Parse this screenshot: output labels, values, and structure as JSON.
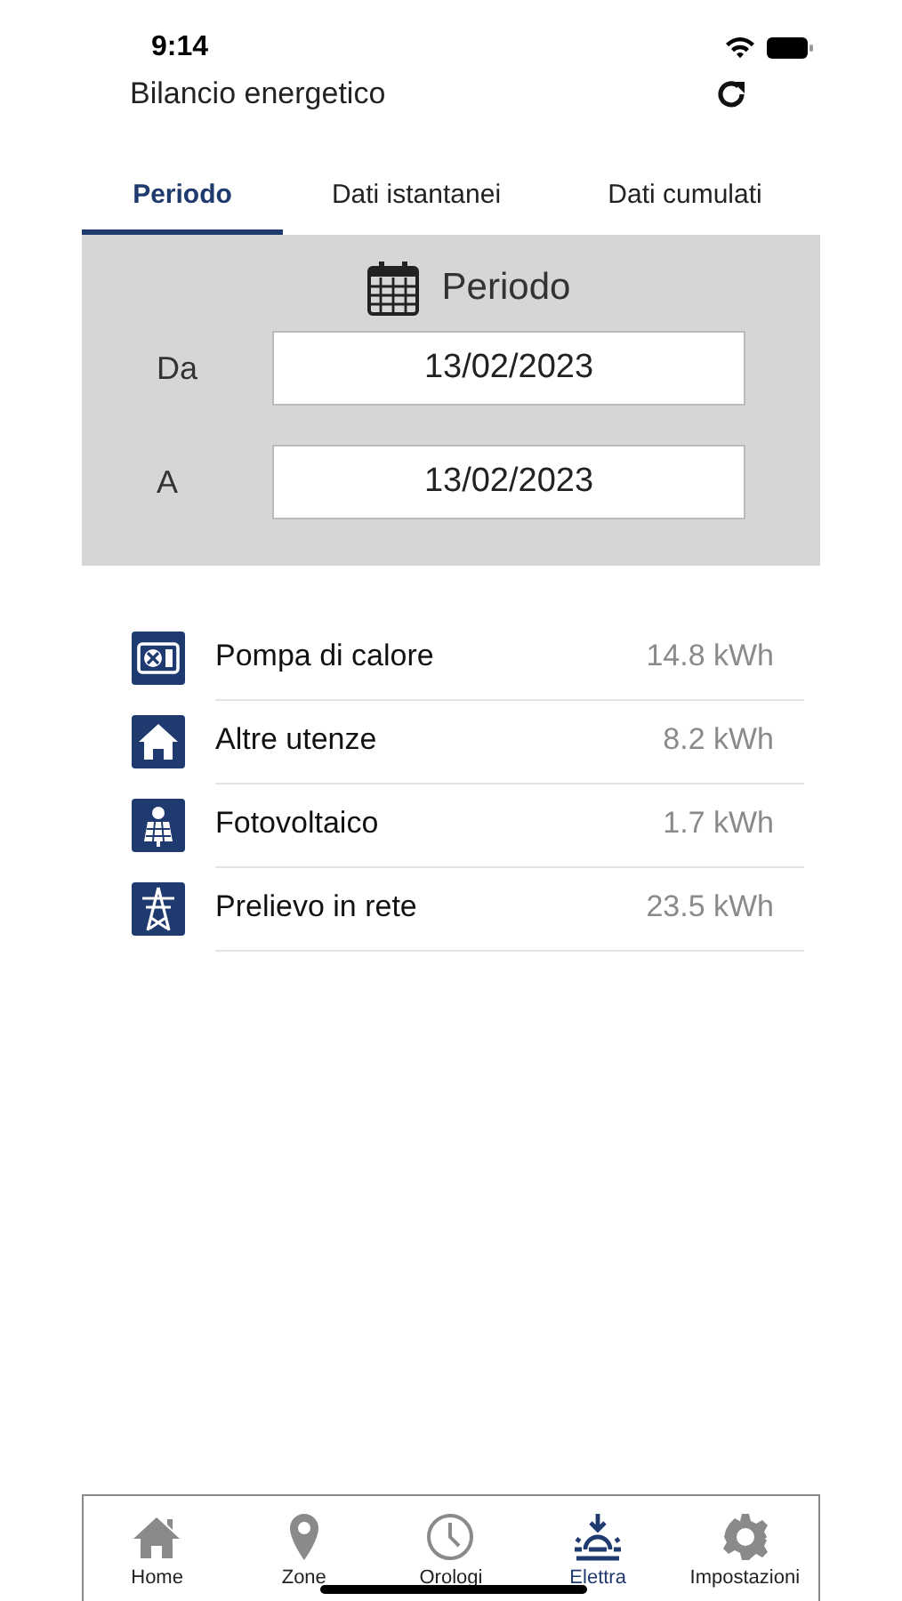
{
  "status_bar": {
    "time": "9:14"
  },
  "header": {
    "title": "Bilancio energetico"
  },
  "tabs": [
    {
      "label": "Periodo",
      "selected": true
    },
    {
      "label": "Dati istantanei",
      "selected": false
    },
    {
      "label": "Dati cumulati",
      "selected": false
    }
  ],
  "period": {
    "title": "Periodo",
    "from_label": "Da",
    "from_value": "13/02/2023",
    "to_label": "A",
    "to_value": "13/02/2023"
  },
  "items": [
    {
      "kind": "heatpump",
      "label": "Pompa di calore",
      "value": "14.8 kWh"
    },
    {
      "kind": "house",
      "label": "Altre utenze",
      "value": "8.2 kWh"
    },
    {
      "kind": "solar",
      "label": "Fotovoltaico",
      "value": "1.7 kWh"
    },
    {
      "kind": "grid",
      "label": "Prelievo in rete",
      "value": "23.5 kWh"
    }
  ],
  "tab_bar": [
    {
      "kind": "home",
      "label": "Home",
      "selected": false
    },
    {
      "kind": "pin",
      "label": "Zone",
      "selected": false
    },
    {
      "kind": "clock",
      "label": "Orologi",
      "selected": false
    },
    {
      "kind": "sun",
      "label": "Elettra",
      "selected": true
    },
    {
      "kind": "gear",
      "label": "Impostazioni",
      "selected": false
    }
  ]
}
